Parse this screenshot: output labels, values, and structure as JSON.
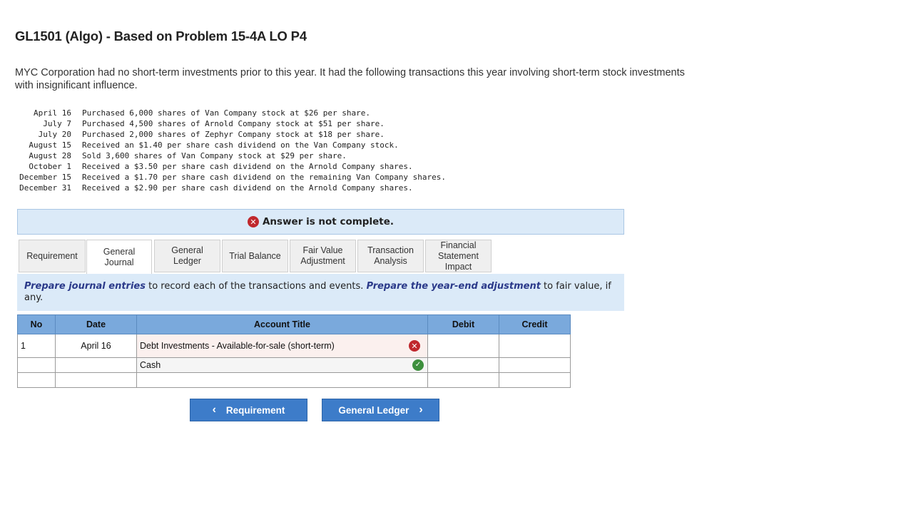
{
  "title": "GL1501 (Algo) - Based on Problem 15-4A LO P4",
  "intro": "MYC Corporation had no short-term investments prior to this year. It had the following transactions this year involving short-term stock investments with insignificant influence.",
  "transactions": [
    {
      "date": "April 16",
      "desc": "Purchased 6,000 shares of Van Company stock at $26 per share."
    },
    {
      "date": "July 7",
      "desc": "Purchased 4,500 shares of Arnold Company stock at $51 per share."
    },
    {
      "date": "July 20",
      "desc": "Purchased 2,000 shares of Zephyr Company stock at $18 per share."
    },
    {
      "date": "August 15",
      "desc": "Received an $1.40 per share cash dividend on the Van Company stock."
    },
    {
      "date": "August 28",
      "desc": "Sold 3,600 shares of Van Company stock at $29 per share."
    },
    {
      "date": "October 1",
      "desc": "Received a $3.50 per share cash dividend on the Arnold Company shares."
    },
    {
      "date": "December 15",
      "desc": "Received a $1.70 per share cash dividend on the remaining Van Company shares."
    },
    {
      "date": "December 31",
      "desc": "Received a $2.90 per share cash dividend on the Arnold Company shares."
    }
  ],
  "banner": {
    "text": "Answer is not complete.",
    "icon": "x-circle-icon",
    "color": "#c0282d"
  },
  "tabs": [
    {
      "label": "Requirement",
      "active": false
    },
    {
      "label": "General Journal",
      "active": true
    },
    {
      "label": "General Ledger",
      "active": false
    },
    {
      "label": "Trial Balance",
      "active": false
    },
    {
      "label": "Fair Value Adjustment",
      "active": false
    },
    {
      "label": "Transaction Analysis",
      "active": false
    },
    {
      "label": "Financial Statement Impact",
      "active": false
    }
  ],
  "instructions": {
    "bold1": "Prepare journal entries",
    "text1": " to record each of the transactions and events.  ",
    "bold2": "Prepare the year-end adjustment",
    "text2": " to fair value, if any."
  },
  "journal": {
    "headers": [
      "No",
      "Date",
      "Account Title",
      "Debit",
      "Credit"
    ],
    "rows": [
      {
        "no": "1",
        "date": "April 16",
        "account": "Debt Investments - Available-for-sale (short-term)",
        "status": "incorrect",
        "debit": "",
        "credit": ""
      },
      {
        "no": "",
        "date": "",
        "account": "Cash",
        "status": "correct",
        "debit": "",
        "credit": ""
      },
      {
        "no": "",
        "date": "",
        "account": "",
        "status": "",
        "debit": "",
        "credit": ""
      }
    ]
  },
  "nav": {
    "prev_label": "Requirement",
    "next_label": "General Ledger"
  },
  "colors": {
    "header_blue": "#7aa9dc",
    "panel_blue": "#dbeaf8",
    "button_blue": "#3d7cc9",
    "error_red": "#c0282d",
    "ok_green": "#3d8f3d"
  }
}
